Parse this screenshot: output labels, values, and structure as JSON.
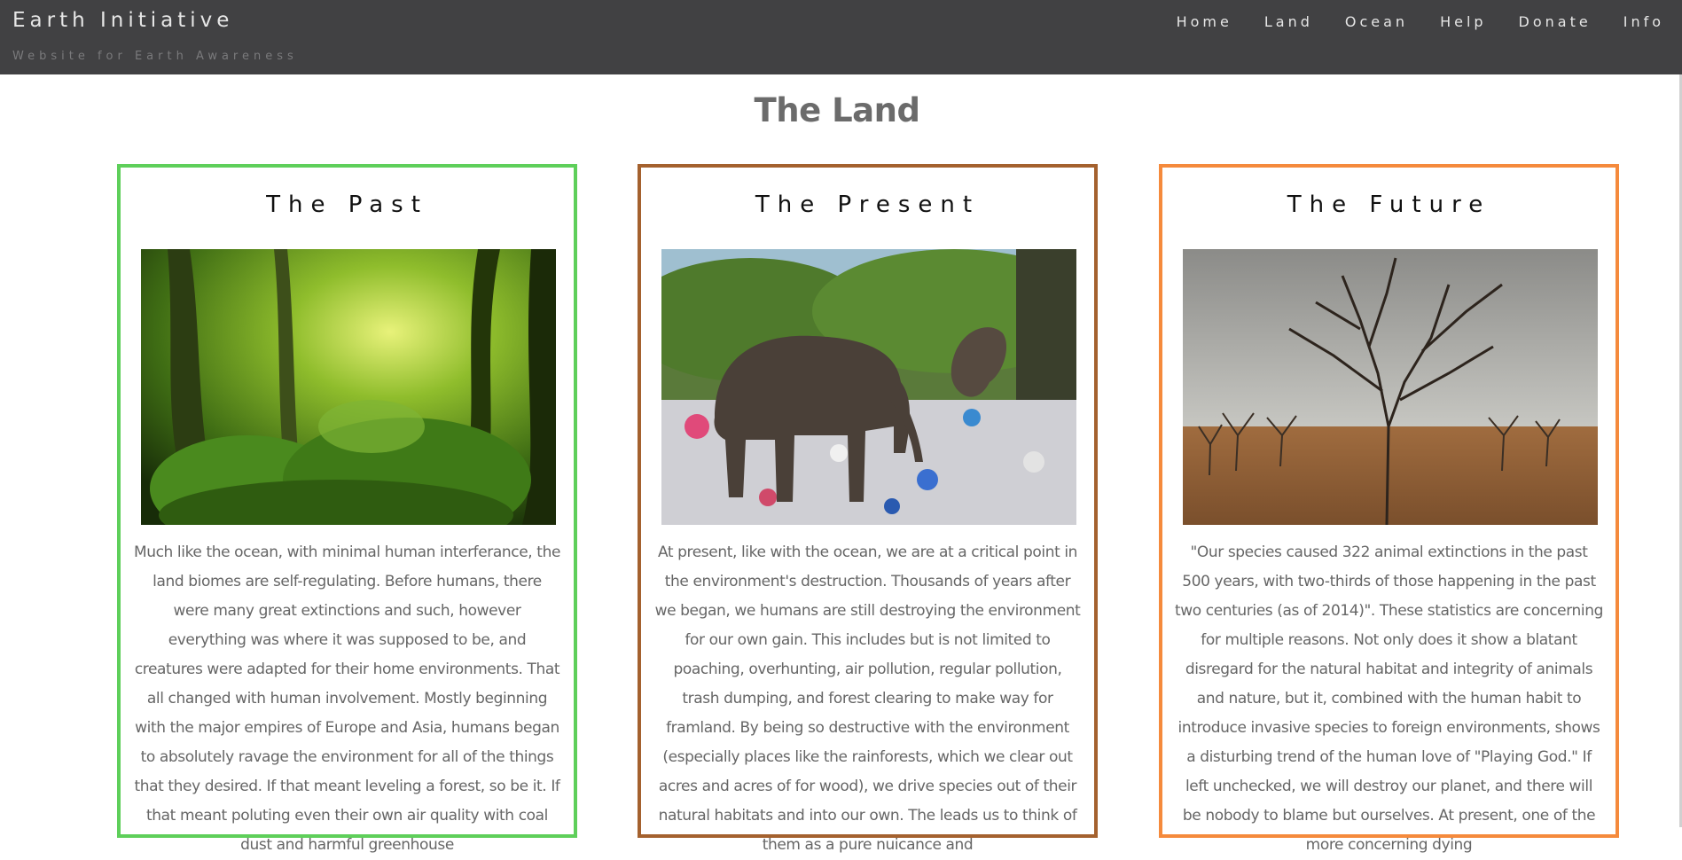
{
  "site": {
    "title": "Earth Initiative",
    "subtitle": "Website for Earth Awareness"
  },
  "nav": {
    "items": [
      "Home",
      "Land",
      "Ocean",
      "Help",
      "Donate",
      "Info"
    ]
  },
  "page": {
    "title": "The Land"
  },
  "cards": [
    {
      "title": "The Past",
      "border_color": "#5ecf5a",
      "image": "jungle-forest-photo",
      "text": "Much like the ocean, with minimal human interferance, the land biomes are self-regulating. Before humans, there were many great extinctions and such, however everything was where it was supposed to be, and creatures were adapted for their home environments. That all changed with human involvement. Mostly beginning with the major empires of Europe and Asia, humans began to absolutely ravage the environment for all of the things that they desired. If that meant leveling a forest, so be it. If that meant poluting even their own air quality with coal dust and harmful greenhouse"
    },
    {
      "title": "The Present",
      "border_color": "#a4612e",
      "image": "elephant-in-trash-photo",
      "text": "At present, like with the ocean, we are at a critical point in the environment's destruction. Thousands of years after we began, we humans are still destroying the environment for our own gain. This includes but is not limited to poaching, overhunting, air pollution, regular pollution, trash dumping, and forest clearing to make way for framland. By being so destructive with the environment (especially places like the rainforests, which we clear out acres and acres of for wood), we drive species out of their natural habitats and into our own. The leads us to think of them as a pure nuicance and"
    },
    {
      "title": "The Future",
      "border_color": "#f58a3c",
      "image": "dead-orchard-photo",
      "text": "\"Our species caused 322 animal extinctions in the past 500 years, with two-thirds of those happening in the past two centuries (as of 2014)\". These statistics are concerning for multiple reasons. Not only does it show a blatant disregard for the natural habitat and integrity of animals and nature, but it, combined with the human habit to introduce invasive species to foreign environments, shows a disturbing trend of the human love of \"Playing God.\" If left unchecked, we will destroy our planet, and there will be nobody to blame but ourselves. At present, one of the more concerning dying"
    }
  ]
}
